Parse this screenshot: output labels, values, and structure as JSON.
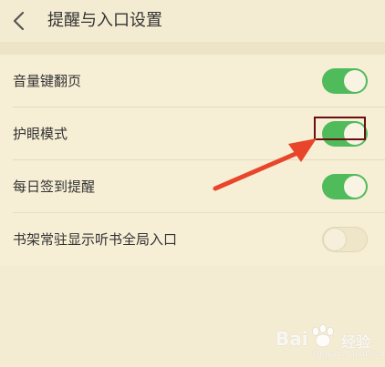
{
  "header": {
    "back_icon": "chevron-left-icon",
    "title": "提醒与入口设置"
  },
  "settings": [
    {
      "label": "音量键翻页",
      "state": "on"
    },
    {
      "label": "护眼模式",
      "state": "on"
    },
    {
      "label": "每日签到提醒",
      "state": "on"
    },
    {
      "label": "书架常驻显示听书全局入口",
      "state": "off"
    }
  ],
  "colors": {
    "toggle_on": "#4fbb5b",
    "background": "#f4ecd2",
    "highlight_box": "#6a0f0f",
    "arrow": "#e8452b"
  },
  "watermark": {
    "brand": "Bai",
    "brand2": "经验",
    "url": "jingyan.baidu.com"
  }
}
